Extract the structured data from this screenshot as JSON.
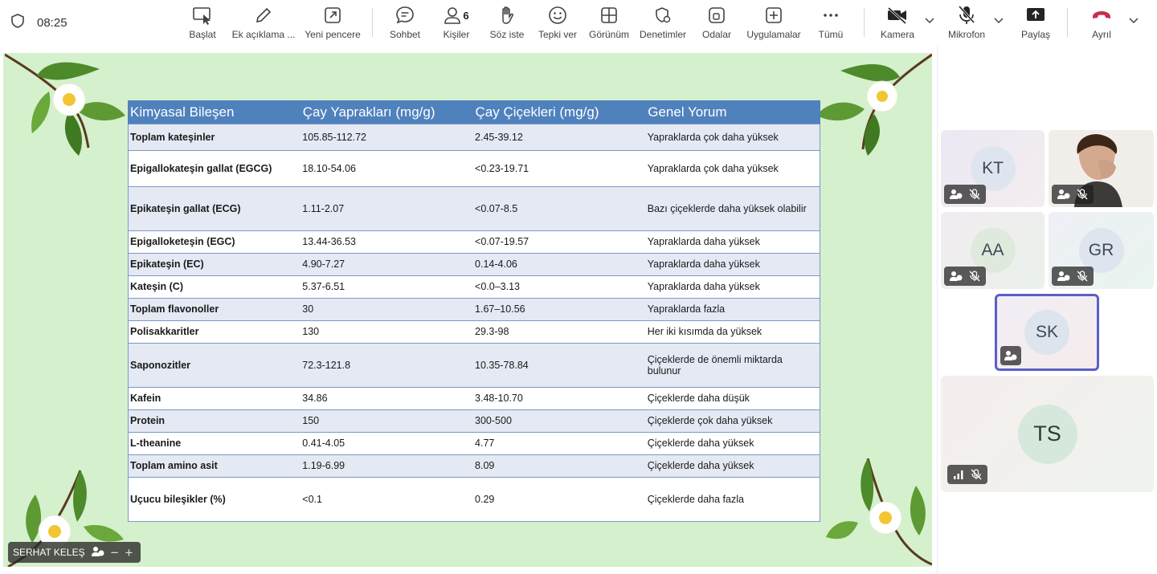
{
  "meeting": {
    "time": "08:25"
  },
  "toolbar": {
    "start": "Başlat",
    "annotate": "Ek açıklama ...",
    "new_window": "Yeni pencere",
    "chat": "Sohbet",
    "people": "Kişiler",
    "people_count": "6",
    "raise_hand": "Söz iste",
    "react": "Tepki ver",
    "view": "Görünüm",
    "controls": "Denetimler",
    "rooms": "Odalar",
    "apps": "Uygulamalar",
    "more": "Tümü",
    "camera": "Kamera",
    "mic": "Mikrofon",
    "share": "Paylaş",
    "leave": "Ayrıl"
  },
  "colors": {
    "accent": "#5b5fc7",
    "leave": "#c4314b",
    "table_header": "#4f81bd",
    "slide_bg": "#d4f0cc"
  },
  "slide": {
    "headers": [
      "Kimyasal Bileşen",
      "Çay Yaprakları (mg/g)",
      "Çay Çiçekleri (mg/g)",
      "Genel Yorum"
    ],
    "rows": [
      [
        "Toplam kateşinler",
        "105.85-112.72",
        "2.45-39.12",
        "Yapraklarda çok daha yüksek"
      ],
      [
        "Epigallokateşin gallat (EGCG)",
        "18.10-54.06",
        "<0.23-19.71",
        "Yapraklarda çok daha yüksek"
      ],
      [
        "Epikateşin gallat (ECG)",
        "1.11-2.07",
        "<0.07-8.5",
        "Bazı çiçeklerde daha yüksek olabilir"
      ],
      [
        "Epigalloketeşin (EGC)",
        "13.44-36.53",
        "<0.07-19.57",
        "Yapraklarda daha yüksek"
      ],
      [
        "Epikateşin (EC)",
        "4.90-7.27",
        "0.14-4.06",
        "Yapraklarda daha yüksek"
      ],
      [
        "Kateşin (C)",
        "5.37-6.51",
        "<0.0–3.13",
        "Yapraklarda daha yüksek"
      ],
      [
        "Toplam flavonoller",
        "30",
        "1.67–10.56",
        "Yapraklarda fazla"
      ],
      [
        "Polisakkaritler",
        "130",
        "29.3-98",
        "Her iki kısımda da yüksek"
      ],
      [
        "Saponozitler",
        "72.3-121.8",
        "10.35-78.84",
        "Çiçeklerde de önemli miktarda bulunur"
      ],
      [
        "Kafein",
        "34.86",
        "3.48-10.70",
        "Çiçeklerde daha düşük"
      ],
      [
        "Protein",
        "150",
        "300-500",
        "Çiçeklerde çok daha yüksek"
      ],
      [
        "L-theanine",
        "0.41-4.05",
        "4.77",
        "Çiçeklerde daha yüksek"
      ],
      [
        "Toplam amino asit",
        "1.19-6.99",
        "8.09",
        "Çiçeklerde daha yüksek"
      ],
      [
        "Uçucu bileşikler (%)",
        "<0.1",
        "0.29",
        "Çiçeklerde  daha fazla"
      ]
    ]
  },
  "presenter": {
    "name": "SERHAT KELEŞ"
  },
  "participants": [
    "KT",
    "AA",
    "GR",
    "SK",
    "TS"
  ]
}
